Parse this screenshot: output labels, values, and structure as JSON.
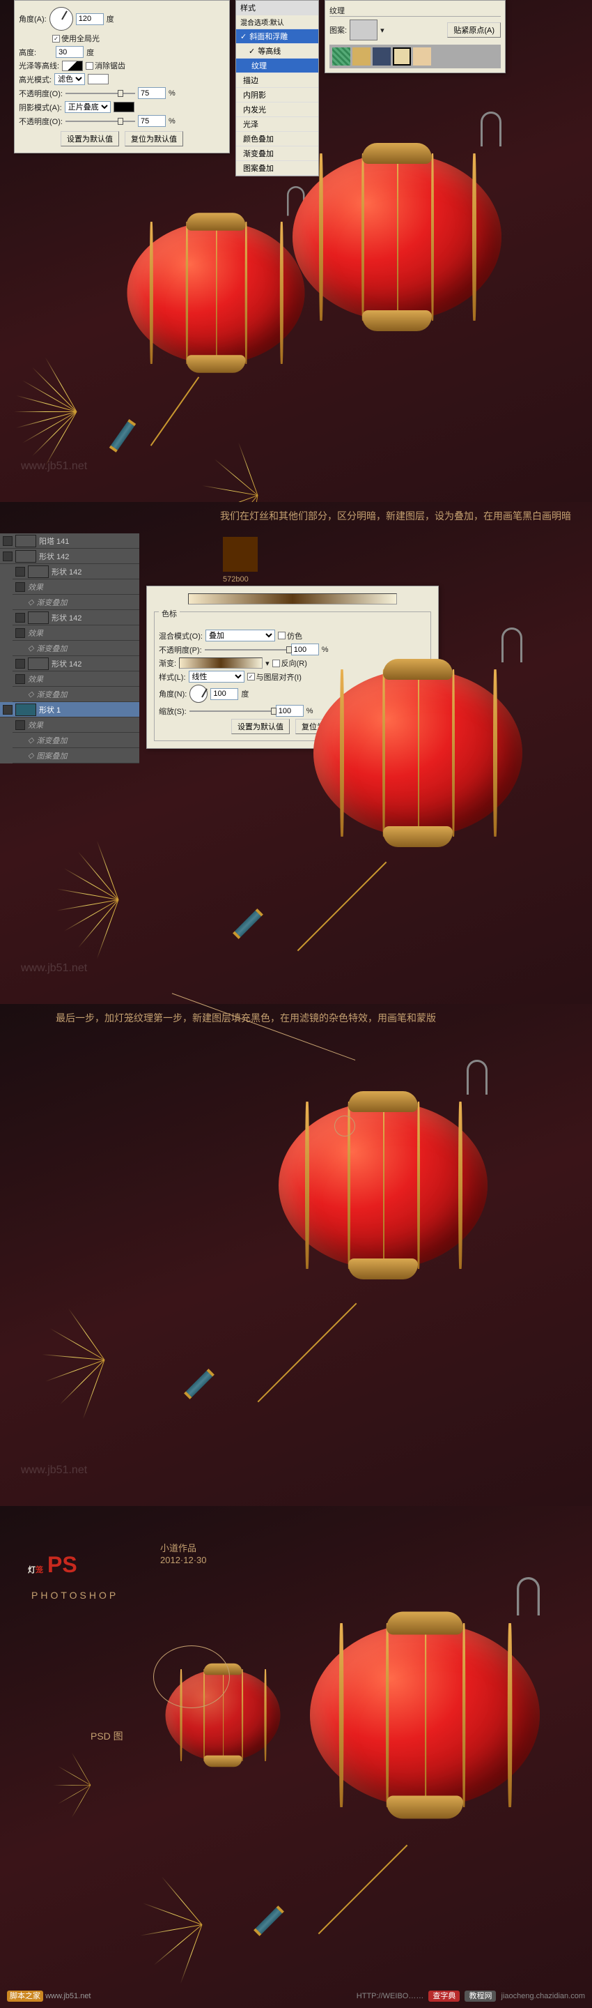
{
  "dialog1": {
    "angle_label": "角度(A):",
    "angle_val": "120",
    "angle_unit": "度",
    "altitude_label": "高度:",
    "altitude_val": "30",
    "altitude_unit": "度",
    "global_light": "使用全局光",
    "gloss_label": "光泽等高线:",
    "anti_alias": "消除锯齿",
    "hl_mode_label": "高光模式:",
    "hl_mode": "滤色",
    "opacity1_label": "不透明度(O):",
    "opacity1_val": "75",
    "pct": "%",
    "shadow_mode_label": "阴影模式(A):",
    "shadow_mode": "正片叠底",
    "opacity2_label": "不透明度(O):",
    "opacity2_val": "75",
    "btn_set": "设置为默认值",
    "btn_reset": "复位为默认值"
  },
  "fxlist": {
    "title": "样式",
    "tab": "混合选项:默认",
    "items": [
      "斜面和浮雕",
      "等高线",
      "纹理",
      "描边",
      "内阴影",
      "内发光",
      "光泽",
      "颜色叠加",
      "渐变叠加",
      "图案叠加"
    ],
    "checked": [
      true,
      true,
      false,
      false,
      false,
      false,
      false,
      false,
      false,
      false
    ],
    "hl": 1
  },
  "pattern": {
    "title": "纹理",
    "pattern_label": "图案:",
    "snap": "贴紧原点(A)"
  },
  "note1": "我们在灯丝和其他们部分，区分明暗，新建图层，设为叠加，在用画笔黑白画明暗",
  "colorcode": "572b00",
  "layers": {
    "rows": [
      {
        "name": "阳塔 141"
      },
      {
        "name": "形状 142"
      },
      {
        "name": "形状 142",
        "sub": true
      },
      {
        "name": "效果",
        "sub": true
      },
      {
        "name": "渐变叠加",
        "sub": true
      },
      {
        "name": "形状 142",
        "sub": true
      },
      {
        "name": "效果",
        "sub": true
      },
      {
        "name": "渐变叠加",
        "sub": true
      },
      {
        "name": "形状 142",
        "sub": true
      },
      {
        "name": "效果",
        "sub": true
      },
      {
        "name": "渐变叠加",
        "sub": true
      },
      {
        "name": "形状 1",
        "hl": true
      },
      {
        "name": "效果",
        "sub": true
      },
      {
        "name": "渐变叠加",
        "sub": true
      },
      {
        "name": "图案叠加",
        "sub": true
      }
    ]
  },
  "dialog2": {
    "group_label": "色标",
    "blend_mode_label": "混合模式(O):",
    "blend_mode": "叠加",
    "opacity_label": "不透明度(P):",
    "opacity_val": "100",
    "gradient_label": "渐变:",
    "reverse": "反向(R)",
    "style_label": "样式(L):",
    "style_val": "线性",
    "align": "与图层对齐(I)",
    "angle_label": "角度(N):",
    "angle_val": "100",
    "angle_unit": "度",
    "zoom_label": "缩放(S):",
    "zoom_val": "100",
    "pct": "%",
    "btn_set": "设置为默认值",
    "btn_reset": "复位为默认值"
  },
  "note2": "最后一步，加灯笼纹理第一步，新建图层填充黑色，在用滤镜的杂色特效，用画笔和蒙版",
  "title": {
    "char1": "灯",
    "char2": "笼",
    "ps": "PS",
    "author": "小道作品",
    "date": "2012·12·30",
    "app": "PHOTOSHOP"
  },
  "psd_label": "PSD 图",
  "footer": {
    "left": "脚本之家",
    "mid": "www.jb51.net",
    "right1": "HTTP://WEIBO……",
    "right2": "查字典",
    "right3": "教程网",
    "right4": "jiaocheng.chazidian.com"
  }
}
